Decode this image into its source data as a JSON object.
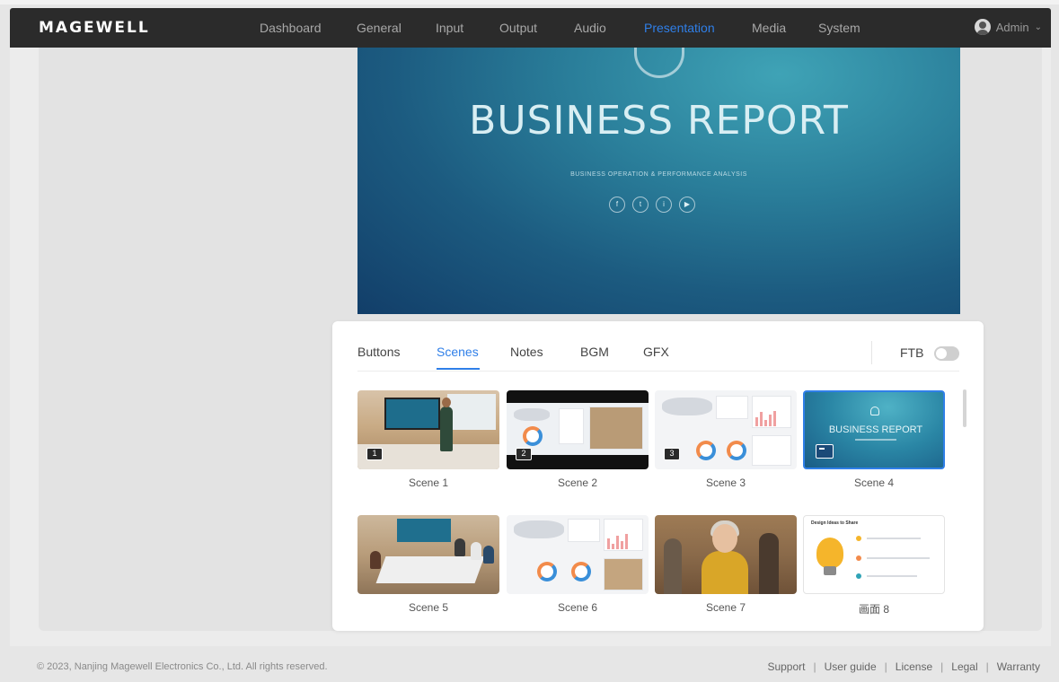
{
  "app": {
    "logo": "MAGEWELL"
  },
  "nav": {
    "items": [
      {
        "label": "Dashboard"
      },
      {
        "label": "General"
      },
      {
        "label": "Input"
      },
      {
        "label": "Output"
      },
      {
        "label": "Audio"
      },
      {
        "label": "Presentation"
      },
      {
        "label": "Media"
      },
      {
        "label": "System"
      }
    ],
    "active": "Presentation",
    "user_label": "Admin"
  },
  "preview": {
    "title": "BUSINESS REPORT",
    "subtitle": "BUSINESS OPERATION & PERFORMANCE ANALYSIS",
    "socials": [
      "f",
      "t",
      "i",
      "▶"
    ]
  },
  "panel": {
    "tabs": [
      {
        "label": "Buttons"
      },
      {
        "label": "Scenes"
      },
      {
        "label": "Notes"
      },
      {
        "label": "BGM"
      },
      {
        "label": "GFX"
      }
    ],
    "active_tab": "Scenes",
    "ftb_label": "FTB",
    "ftb_on": false,
    "scenes": [
      {
        "label": "Scene 1",
        "badge": "1"
      },
      {
        "label": "Scene 2",
        "badge": "2"
      },
      {
        "label": "Scene 3",
        "badge": "3"
      },
      {
        "label": "Scene 4",
        "badge": "",
        "selected": true,
        "thumb_title": "BUSINESS REPORT"
      },
      {
        "label": "Scene 5",
        "badge": ""
      },
      {
        "label": "Scene 6",
        "badge": ""
      },
      {
        "label": "Scene 7",
        "badge": ""
      },
      {
        "label": "画面 8",
        "badge": "",
        "thumb_title": "Design Ideas to Share"
      }
    ]
  },
  "footer": {
    "copyright": "© 2023, Nanjing Magewell Electronics Co., Ltd. All rights reserved.",
    "links": [
      "Support",
      "User guide",
      "License",
      "Legal",
      "Warranty"
    ]
  },
  "colors": {
    "accent": "#2f7fe8",
    "topbar": "#2b2b2b"
  }
}
